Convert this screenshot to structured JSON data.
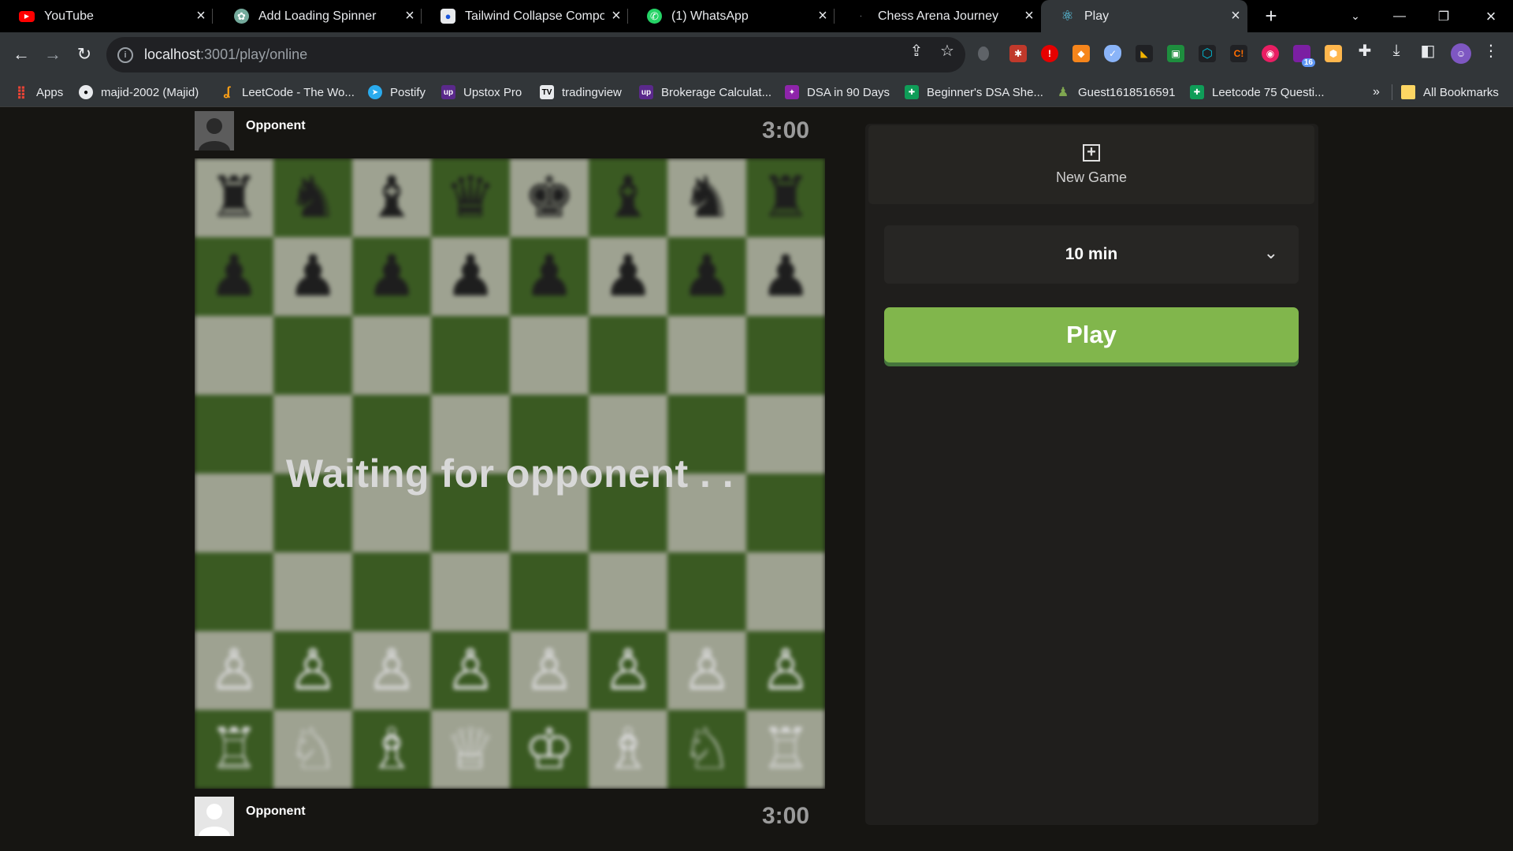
{
  "browser": {
    "tabs": [
      {
        "title": "YouTube",
        "favicon": "youtube-icon",
        "color": "#ff0000"
      },
      {
        "title": "Add Loading Spinner",
        "favicon": "chatgpt-icon",
        "color": "#74aa9c"
      },
      {
        "title": "Tailwind Collapse Compon",
        "favicon": "flowbite-icon",
        "color": "#5a8dee"
      },
      {
        "title": "(1) WhatsApp",
        "favicon": "whatsapp-icon",
        "color": "#25d366"
      },
      {
        "title": "Chess Arena Journey",
        "favicon": "chess-icon",
        "color": "#3b3b3b"
      },
      {
        "title": "Play",
        "favicon": "react-icon",
        "color": "#61dafb"
      }
    ],
    "url_host": "localhost",
    "url_path": ":3001/play/online",
    "extension_badge": "16",
    "bookmarks": [
      {
        "label": "Apps",
        "icon": "apps-grid-icon"
      },
      {
        "label": "majid-2002 (Majid)",
        "icon": "github-icon"
      },
      {
        "label": "LeetCode - The Wo...",
        "icon": "leetcode-icon"
      },
      {
        "label": "Postify",
        "icon": "telegram-icon"
      },
      {
        "label": "Upstox Pro",
        "icon": "upstox-icon"
      },
      {
        "label": "tradingview",
        "icon": "tradingview-icon"
      },
      {
        "label": "Brokerage Calculat...",
        "icon": "upstox-icon"
      },
      {
        "label": "DSA in 90 Days",
        "icon": "dsa-icon"
      },
      {
        "label": "Beginner's DSA She...",
        "icon": "sheets-icon"
      },
      {
        "label": "Guest1618516591",
        "icon": "chess-pawn-icon"
      },
      {
        "label": "Leetcode 75 Questi...",
        "icon": "sheets-icon"
      }
    ],
    "more_bookmarks": "»",
    "all_bookmarks": "All Bookmarks"
  },
  "game": {
    "top_player": {
      "name": "Opponent",
      "clock": "3:00"
    },
    "bottom_player": {
      "name": "Opponent",
      "clock": "3:00"
    },
    "overlay_text": "Waiting for opponent . .",
    "board": [
      [
        "♜",
        "♞",
        "♝",
        "♛",
        "♚",
        "♝",
        "♞",
        "♜"
      ],
      [
        "♟",
        "♟",
        "♟",
        "♟",
        "♟",
        "♟",
        "♟",
        "♟"
      ],
      [
        "",
        "",
        "",
        "",
        "",
        "",
        "",
        ""
      ],
      [
        "",
        "",
        "",
        "",
        "",
        "",
        "",
        ""
      ],
      [
        "",
        "",
        "",
        "",
        "",
        "",
        "",
        ""
      ],
      [
        "",
        "",
        "",
        "",
        "",
        "",
        "",
        ""
      ],
      [
        "♙",
        "♙",
        "♙",
        "♙",
        "♙",
        "♙",
        "♙",
        "♙"
      ],
      [
        "♖",
        "♘",
        "♗",
        "♕",
        "♔",
        "♗",
        "♘",
        "♖"
      ]
    ]
  },
  "panel": {
    "new_game_label": "New Game",
    "time_control": "10 min",
    "play_label": "Play"
  },
  "colors": {
    "play_green": "#81b64c",
    "board_light": "#9ea291",
    "board_dark": "#3a5a22"
  }
}
